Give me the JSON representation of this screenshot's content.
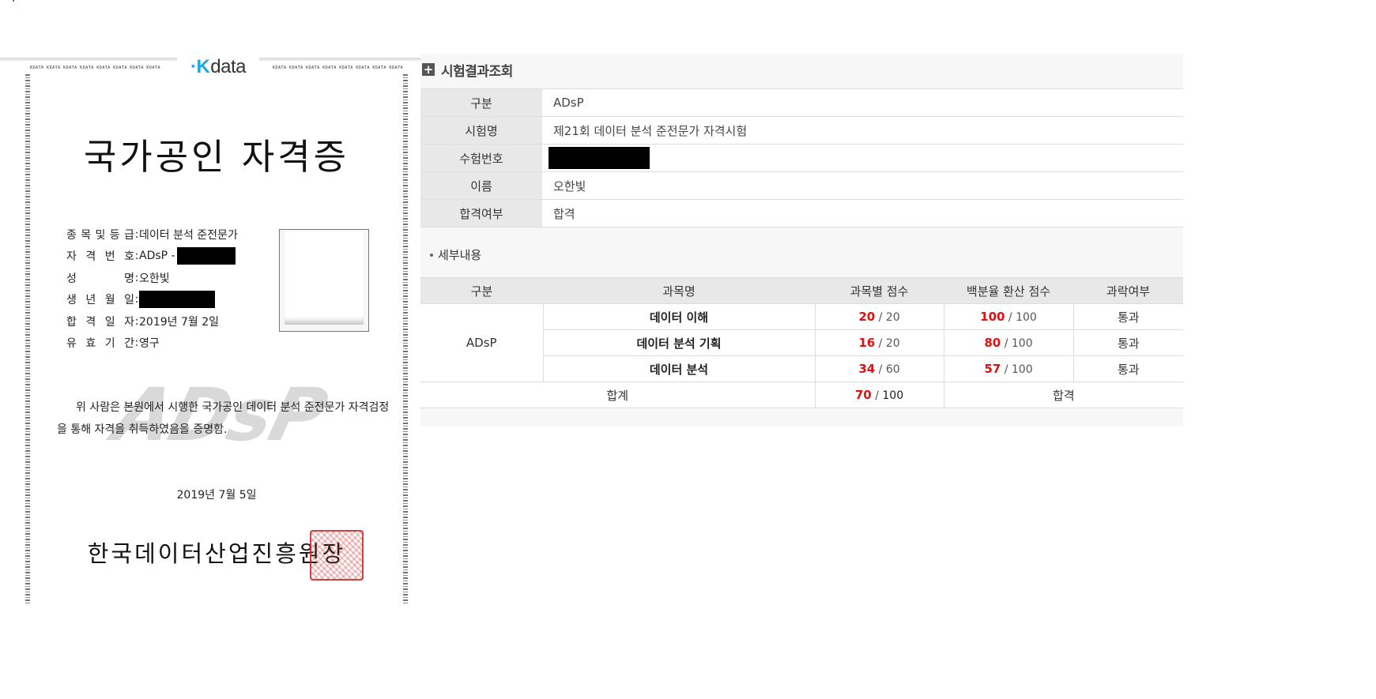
{
  "certificate": {
    "logo": "data",
    "border_strip": "KDATA KDATA KDATA KDATA KDATA KDATA KDATA KDATA",
    "title": "국가공인 자격증",
    "fields": [
      {
        "label_chars": [
          "종",
          "목",
          "및",
          "등",
          "급"
        ],
        "value": "데이터 분석 준전문가",
        "redacted_width": 0
      },
      {
        "label_chars": [
          "자",
          "격",
          "번",
          "호"
        ],
        "value": "ADsP -",
        "redacted_width": 74
      },
      {
        "label_chars": [
          "성",
          "명"
        ],
        "value": "오한빛",
        "redacted_width": 0
      },
      {
        "label_chars": [
          "생",
          "년",
          "월",
          "일"
        ],
        "value": "",
        "redacted_width": 96
      },
      {
        "label_chars": [
          "합",
          "격",
          "일",
          "자"
        ],
        "value": "2019년 7월 2일",
        "redacted_width": 0
      },
      {
        "label_chars": [
          "유",
          "효",
          "기",
          "간"
        ],
        "value": "영구",
        "redacted_width": 0
      }
    ],
    "watermark": "ADsP",
    "statement": "위 사람은 본원에서 시행한 국가공인 데이터 분석 준전문가 자격검정을 통해 자격을 취득하였음을 증명함.",
    "issue_date": "2019년 7월 5일",
    "issuer": "한국데이터산업진흥원장"
  },
  "results": {
    "title": "시험결과조회",
    "info": [
      {
        "label": "구분",
        "value": "ADsP"
      },
      {
        "label": "시험명",
        "value": "제21회 데이터 분석 준전문가 자격시험"
      },
      {
        "label": "수험번호",
        "value": ""
      },
      {
        "label": "이름",
        "value": "오한빛"
      },
      {
        "label": "합격여부",
        "value": "합격"
      }
    ],
    "detail_title": "세부내용",
    "detail_headers": [
      "구분",
      "과목명",
      "과목별 점수",
      "백분율 환산 점수",
      "과락여부"
    ],
    "category": "ADsP",
    "subjects": [
      {
        "name": "데이터 이해",
        "score": "20",
        "max": "20",
        "pct": "100",
        "pct_max": "100",
        "status": "통과"
      },
      {
        "name": "데이터 분석 기획",
        "score": "16",
        "max": "20",
        "pct": "80",
        "pct_max": "100",
        "status": "통과"
      },
      {
        "name": "데이터 분석",
        "score": "34",
        "max": "60",
        "pct": "57",
        "pct_max": "100",
        "status": "통과"
      }
    ],
    "total": {
      "label": "합계",
      "score": "70",
      "max": "100",
      "result": "합격"
    }
  }
}
